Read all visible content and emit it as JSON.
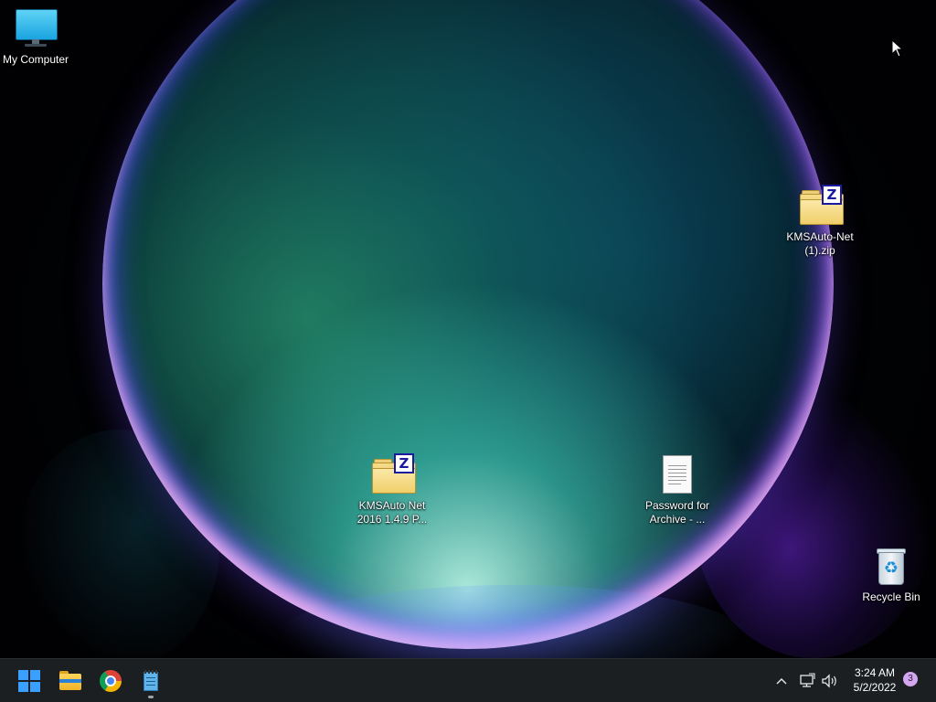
{
  "desktop": {
    "icons": {
      "my_computer": {
        "label": "My Computer",
        "icon": "monitor-icon"
      },
      "kmsauto_zip": {
        "label": "KMSAuto-Net (1).zip",
        "icon": "zip-folder-icon"
      },
      "kmsauto_archive": {
        "label": "KMSAuto Net 2016 1.4.9 P...",
        "icon": "zip-folder-icon"
      },
      "password_file": {
        "label": "Password for Archive - ...",
        "icon": "text-document-icon"
      },
      "recycle_bin": {
        "label": "Recycle Bin",
        "icon": "recycle-bin-icon"
      }
    }
  },
  "taskbar": {
    "apps": [
      {
        "name": "Start",
        "icon": "windows-logo-icon"
      },
      {
        "name": "File Explorer",
        "icon": "folder-icon"
      },
      {
        "name": "Google Chrome",
        "icon": "chrome-icon"
      },
      {
        "name": "Notepad",
        "icon": "notepad-icon",
        "running": true
      }
    ],
    "tray": {
      "chevron": "^",
      "network_icon": "network-icon",
      "volume_icon": "volume-icon",
      "time": "3:24 AM",
      "date": "5/2/2022",
      "notification_count": "3"
    }
  },
  "colors": {
    "taskbar_bg": "#1c1f22",
    "start_accent": "#3aa0ff",
    "notification_badge": "#d3a6f0"
  }
}
